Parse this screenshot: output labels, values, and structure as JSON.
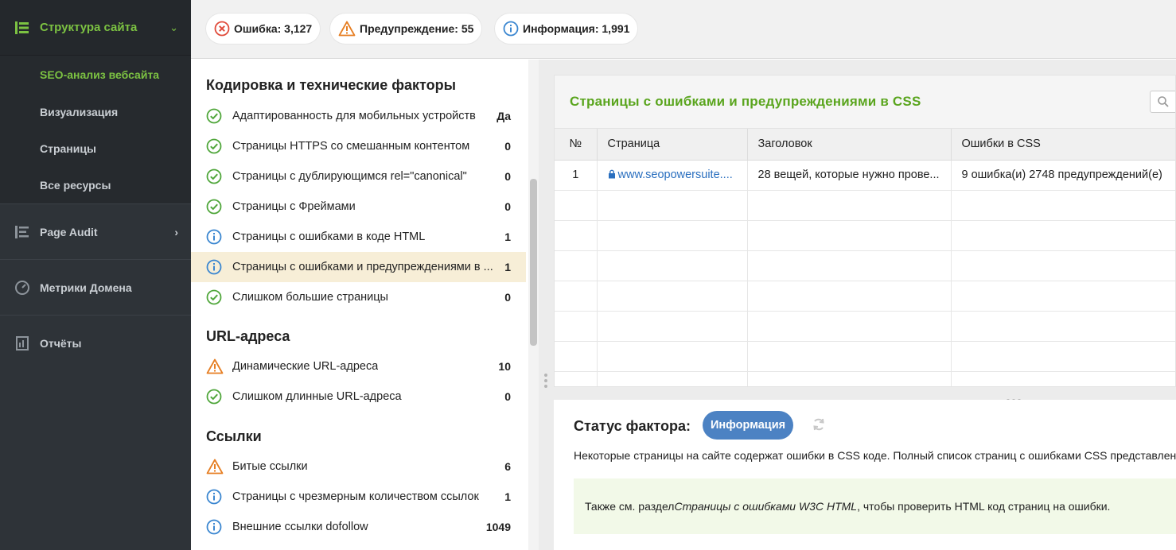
{
  "sidebar": {
    "top": {
      "label": "Структура сайта"
    },
    "sub_items": [
      {
        "label": "SEO-анализ вебсайта",
        "active": true
      },
      {
        "label": "Визуализация"
      },
      {
        "label": "Страницы"
      },
      {
        "label": "Все ресурсы"
      }
    ],
    "sections": [
      {
        "label": "Page Audit"
      },
      {
        "label": "Метрики Домена"
      },
      {
        "label": "Отчёты"
      }
    ]
  },
  "topbar": {
    "error": {
      "label": "Ошибка: 3,127"
    },
    "warning": {
      "label": "Предупреждение: 55"
    },
    "info": {
      "label": "Информация: 1,991"
    }
  },
  "groups": [
    {
      "title": "Кодировка и технические факторы",
      "rows": [
        {
          "status": "ok",
          "text": "Адаптированность для мобильных устройств",
          "value": "Да"
        },
        {
          "status": "ok",
          "text": "Страницы HTTPS со смешанным контентом",
          "value": "0"
        },
        {
          "status": "ok",
          "text": "Страницы с дублирующимся rel=\"canonical\"",
          "value": "0"
        },
        {
          "status": "ok",
          "text": "Страницы с Фреймами",
          "value": "0"
        },
        {
          "status": "info",
          "text": "Страницы с ошибками в коде HTML",
          "value": "1"
        },
        {
          "status": "info",
          "text": "Страницы с ошибками и предупреждениями в ...",
          "value": "1",
          "selected": true
        },
        {
          "status": "ok",
          "text": "Слишком большие страницы",
          "value": "0"
        }
      ]
    },
    {
      "title": "URL-адреса",
      "rows": [
        {
          "status": "warn",
          "text": "Динамические URL-адреса",
          "value": "10"
        },
        {
          "status": "ok",
          "text": "Слишком длинные URL-адреса",
          "value": "0"
        }
      ]
    },
    {
      "title": "Ссылки",
      "rows": [
        {
          "status": "warn",
          "text": "Битые ссылки",
          "value": "6"
        },
        {
          "status": "info",
          "text": "Страницы с чрезмерным количеством ссылок",
          "value": "1"
        },
        {
          "status": "info",
          "text": "Внешние ссылки dofollow",
          "value": "1049"
        }
      ]
    }
  ],
  "details": {
    "title": "Страницы с ошибками и предупреждениями в  CSS",
    "table": {
      "headers": [
        "№",
        "Страница",
        "Заголовок",
        "Ошибки в CSS"
      ],
      "rows": [
        [
          "1",
          "www.seopowersuite....",
          "28 вещей, которые нужно прове...",
          "9 ошибка(и) 2748 предупреждений(е)"
        ]
      ]
    },
    "status_label": "Статус фактора:",
    "status_badge": "Информация",
    "description": "Некоторые страницы на сайте содержат ошибки в CSS коде. Полный список страниц с ошибками CSS представлен ниже.",
    "note": {
      "prefix": "Также см. раздел ",
      "link": "Страницы с ошибками W3C HTML",
      "suffix": ", чтобы проверить HTML код страниц на ошибки."
    }
  },
  "colors": {
    "accent_green": "#7cc242",
    "title_green": "#5aa51e",
    "ok": "#4fa63a",
    "warn": "#e67e22",
    "error": "#e04a3a",
    "info": "#3a86d0",
    "badge_blue": "#4c82c3"
  }
}
